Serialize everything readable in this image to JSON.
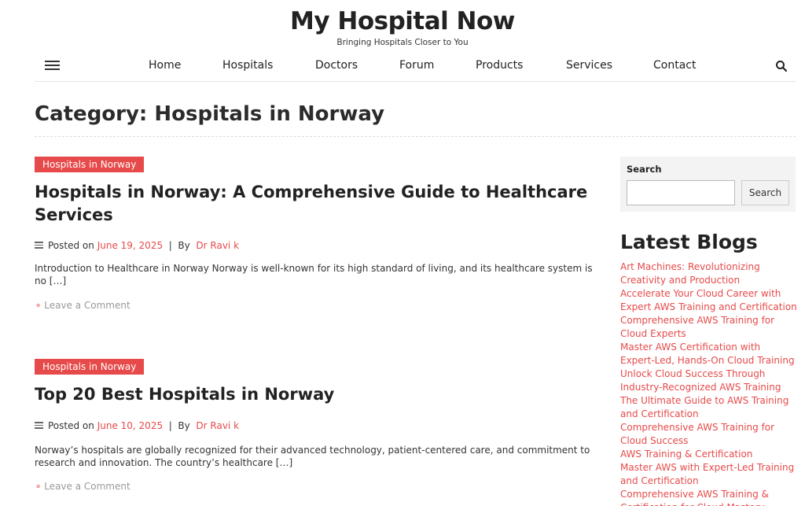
{
  "header": {
    "title": "My Hospital Now",
    "tagline": "Bringing Hospitals Closer to You"
  },
  "nav": {
    "items": [
      "Home",
      "Hospitals",
      "Doctors",
      "Forum",
      "Products",
      "Services",
      "Contact"
    ],
    "menu_icon": "hamburger-menu-icon",
    "search_icon": "search-icon"
  },
  "page": {
    "category_title": "Category: Hospitals in Norway"
  },
  "posts": [
    {
      "category": "Hospitals in Norway",
      "title": "Hospitals in Norway: A Comprehensive Guide to Healthcare Services",
      "posted_on": "Posted on",
      "date": "June 19, 2025",
      "separator": "|",
      "by": "By",
      "author": "Dr Ravi k",
      "excerpt": "Introduction to Healthcare in Norway Norway is well-known for its high standard of living, and its healthcare system is no […]",
      "comment_label": "Leave a Comment"
    },
    {
      "category": "Hospitals in Norway",
      "title": "Top 20 Best Hospitals in Norway",
      "posted_on": "Posted on",
      "date": "June 10, 2025",
      "separator": "|",
      "by": "By",
      "author": "Dr Ravi k",
      "excerpt": "Norway’s hospitals are globally recognized for their advanced technology, patient-centered care, and commitment to research and innovation. The country’s healthcare […]",
      "comment_label": "Leave a Comment"
    }
  ],
  "sidebar": {
    "search_label": "Search",
    "search_value": "",
    "search_button": "Search",
    "latest_title": "Latest Blogs",
    "latest_items": [
      "Art Machines: Revolutionizing Creativity and Production",
      "Accelerate Your Cloud Career with Expert AWS Training and Certification",
      "Comprehensive AWS Training for Cloud Experts",
      "Master AWS Certification with Expert-Led, Hands-On Cloud Training",
      "Unlock Cloud Success Through Industry-Recognized AWS Training",
      "The Ultimate Guide to AWS Training and Certification",
      "Comprehensive AWS Training for Cloud Success",
      "AWS Training & Certification",
      "Master AWS with Expert-Led Training and Certification",
      "Comprehensive AWS Training & Certification for Cloud Mastery"
    ]
  },
  "colors": {
    "accent": "#e74a4a",
    "text": "#2b2b2b",
    "muted": "#999999",
    "sidebar_bg": "#f3f3f3"
  }
}
